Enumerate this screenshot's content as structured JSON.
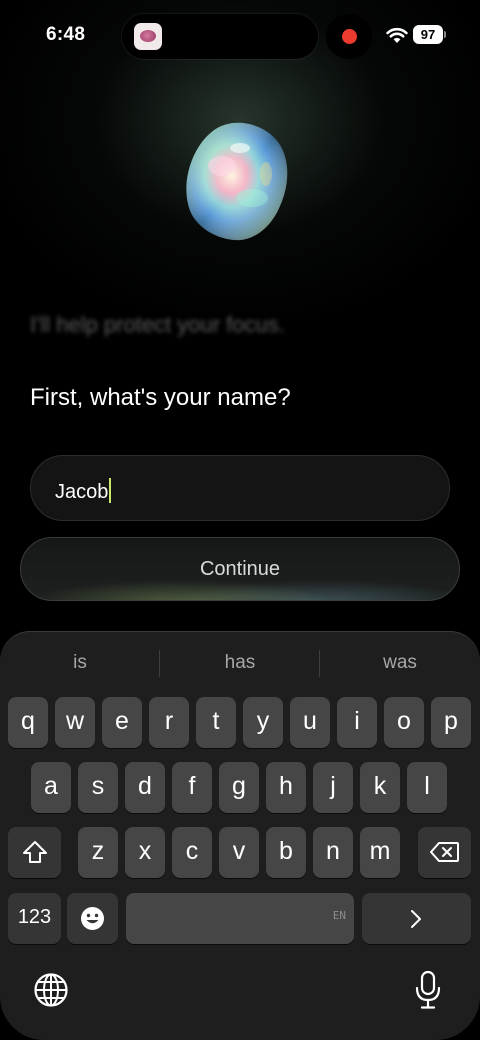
{
  "status_bar": {
    "time": "6:48",
    "battery": "97",
    "recording_color": "#ee3b30"
  },
  "onboarding": {
    "faded_message": "I'll help protect your focus.",
    "question": "First, what's your name?",
    "name_input": {
      "value": "Jacob"
    },
    "continue_label": "Continue"
  },
  "keyboard": {
    "suggestions": [
      "is",
      "has",
      "was"
    ],
    "row1": [
      "q",
      "w",
      "e",
      "r",
      "t",
      "y",
      "u",
      "i",
      "o",
      "p"
    ],
    "row2": [
      "a",
      "s",
      "d",
      "f",
      "g",
      "h",
      "j",
      "k",
      "l"
    ],
    "row3": [
      "z",
      "x",
      "c",
      "v",
      "b",
      "n",
      "m"
    ],
    "numbers_key": "123",
    "space_language": "EN",
    "icons": {
      "shift": "shift-icon",
      "delete": "backspace-icon",
      "emoji": "emoji-icon",
      "return": "chevron-right-icon",
      "globe": "globe-icon",
      "dictation": "microphone-icon"
    }
  }
}
